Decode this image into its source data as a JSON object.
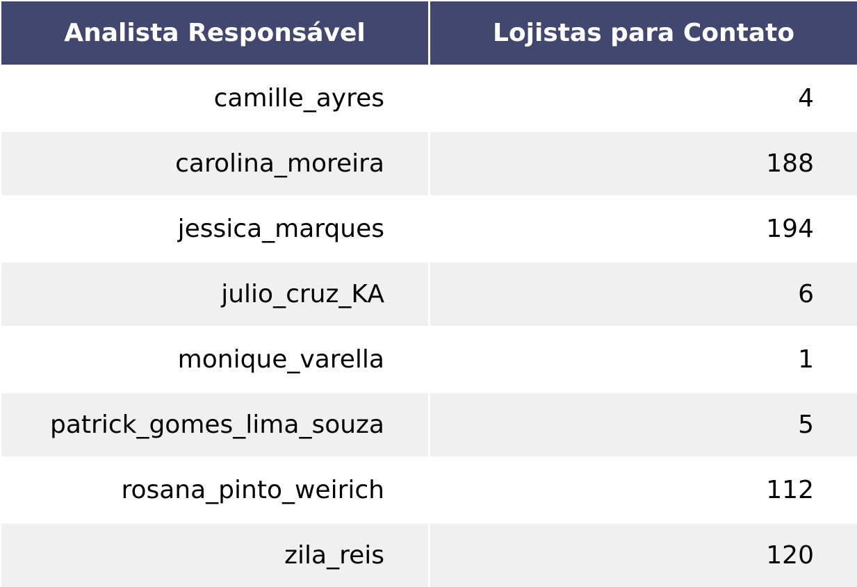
{
  "chart_data": {
    "type": "table",
    "columns": [
      "Analista Responsável",
      "Lojistas para Contato"
    ],
    "rows": [
      [
        "camille_ayres",
        "4"
      ],
      [
        "carolina_moreira",
        "188"
      ],
      [
        "jessica_marques",
        "194"
      ],
      [
        "julio_cruz_KA",
        "6"
      ],
      [
        "monique_varella",
        "1"
      ],
      [
        "patrick_gomes_lima_souza",
        "5"
      ],
      [
        "rosana_pinto_weirich",
        "112"
      ],
      [
        "zila_reis",
        "120"
      ]
    ]
  },
  "colors": {
    "header_bg": "#41476f",
    "header_text": "#ffffff",
    "row_odd_bg": "#ffffff",
    "row_even_bg": "#f0f0f0",
    "body_text": "#000000"
  }
}
